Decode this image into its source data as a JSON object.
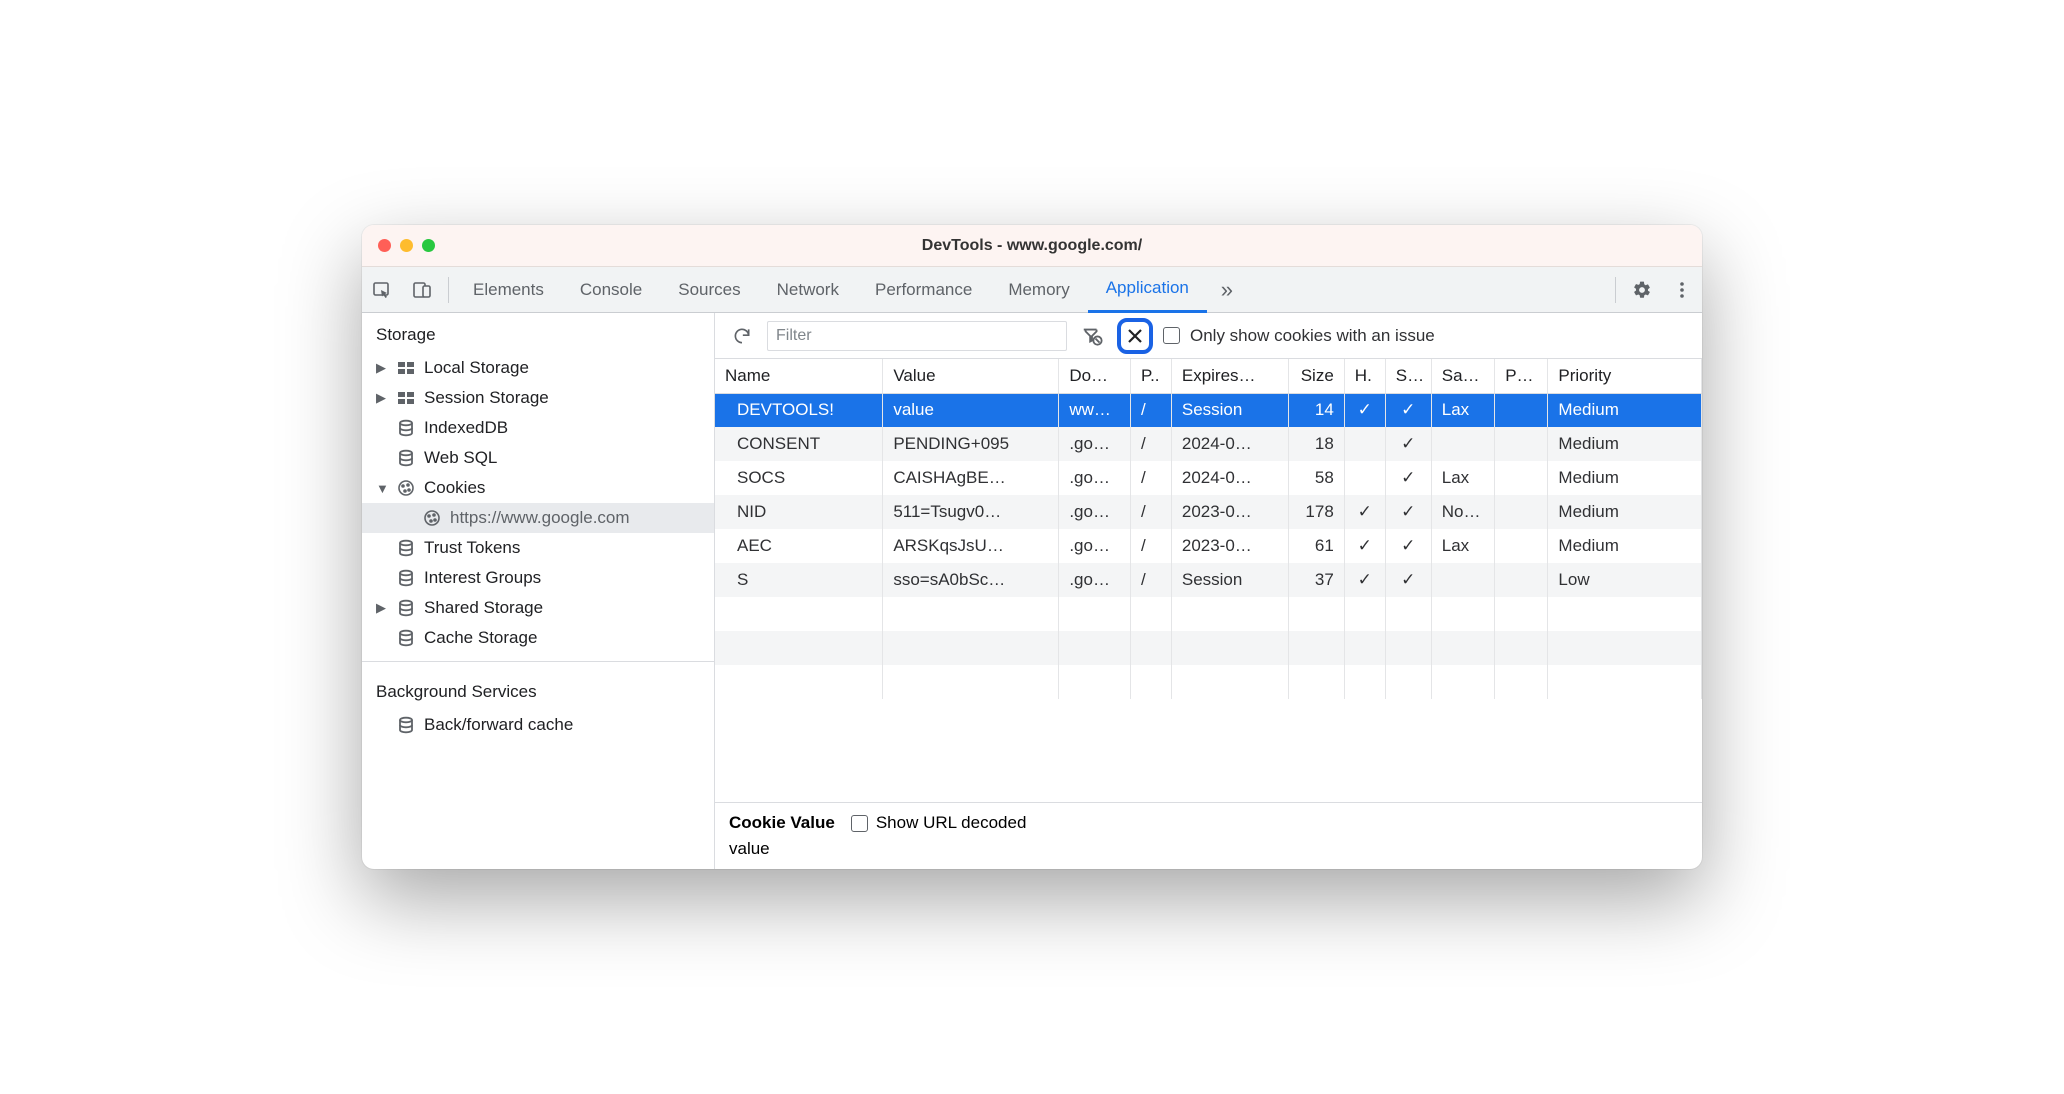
{
  "window_title": "DevTools - www.google.com/",
  "tabs": [
    "Elements",
    "Console",
    "Sources",
    "Network",
    "Performance",
    "Memory",
    "Application"
  ],
  "active_tab": "Application",
  "filter_placeholder": "Filter",
  "only_issue_label": "Only show cookies with an issue",
  "sidebar": {
    "section1_title": "Storage",
    "items": [
      {
        "label": "Local Storage",
        "icon": "storage",
        "toggle": "▶"
      },
      {
        "label": "Session Storage",
        "icon": "storage",
        "toggle": "▶"
      },
      {
        "label": "IndexedDB",
        "icon": "db",
        "toggle": ""
      },
      {
        "label": "Web SQL",
        "icon": "db",
        "toggle": ""
      },
      {
        "label": "Cookies",
        "icon": "cookie",
        "toggle": "▼"
      },
      {
        "label": "https://www.google.com",
        "icon": "cookie",
        "toggle": "",
        "indent": true,
        "selected": true
      },
      {
        "label": "Trust Tokens",
        "icon": "db",
        "toggle": ""
      },
      {
        "label": "Interest Groups",
        "icon": "db",
        "toggle": ""
      },
      {
        "label": "Shared Storage",
        "icon": "db",
        "toggle": "▶"
      },
      {
        "label": "Cache Storage",
        "icon": "db",
        "toggle": ""
      }
    ],
    "section2_title": "Background Services",
    "items2": [
      {
        "label": "Back/forward cache",
        "icon": "db",
        "toggle": ""
      }
    ]
  },
  "columns": [
    "Name",
    "Value",
    "Do…",
    "P..",
    "Expires…",
    "Size",
    "H.",
    "S…",
    "Sa…",
    "P…",
    "Priority"
  ],
  "rows": [
    {
      "name": "DEVTOOLS!",
      "value": "value",
      "domain": "ww…",
      "path": "/",
      "expires": "Session",
      "size": "14",
      "http": "✓",
      "secure": "✓",
      "same": "Lax",
      "part": "",
      "prio": "Medium",
      "selected": true
    },
    {
      "name": "CONSENT",
      "value": "PENDING+095",
      "domain": ".go…",
      "path": "/",
      "expires": "2024-0…",
      "size": "18",
      "http": "",
      "secure": "✓",
      "same": "",
      "part": "",
      "prio": "Medium"
    },
    {
      "name": "SOCS",
      "value": "CAISHAgBE…",
      "domain": ".go…",
      "path": "/",
      "expires": "2024-0…",
      "size": "58",
      "http": "",
      "secure": "✓",
      "same": "Lax",
      "part": "",
      "prio": "Medium"
    },
    {
      "name": "NID",
      "value": "511=Tsugv0…",
      "domain": ".go…",
      "path": "/",
      "expires": "2023-0…",
      "size": "178",
      "http": "✓",
      "secure": "✓",
      "same": "No…",
      "part": "",
      "prio": "Medium"
    },
    {
      "name": "AEC",
      "value": "ARSKqsJsU…",
      "domain": ".go…",
      "path": "/",
      "expires": "2023-0…",
      "size": "61",
      "http": "✓",
      "secure": "✓",
      "same": "Lax",
      "part": "",
      "prio": "Medium"
    },
    {
      "name": "S",
      "value": "sso=sA0bSc…",
      "domain": ".go…",
      "path": "/",
      "expires": "Session",
      "size": "37",
      "http": "✓",
      "secure": "✓",
      "same": "",
      "part": "",
      "prio": "Low"
    }
  ],
  "detail": {
    "label": "Cookie Value",
    "show_decoded": "Show URL decoded",
    "value": "value"
  }
}
